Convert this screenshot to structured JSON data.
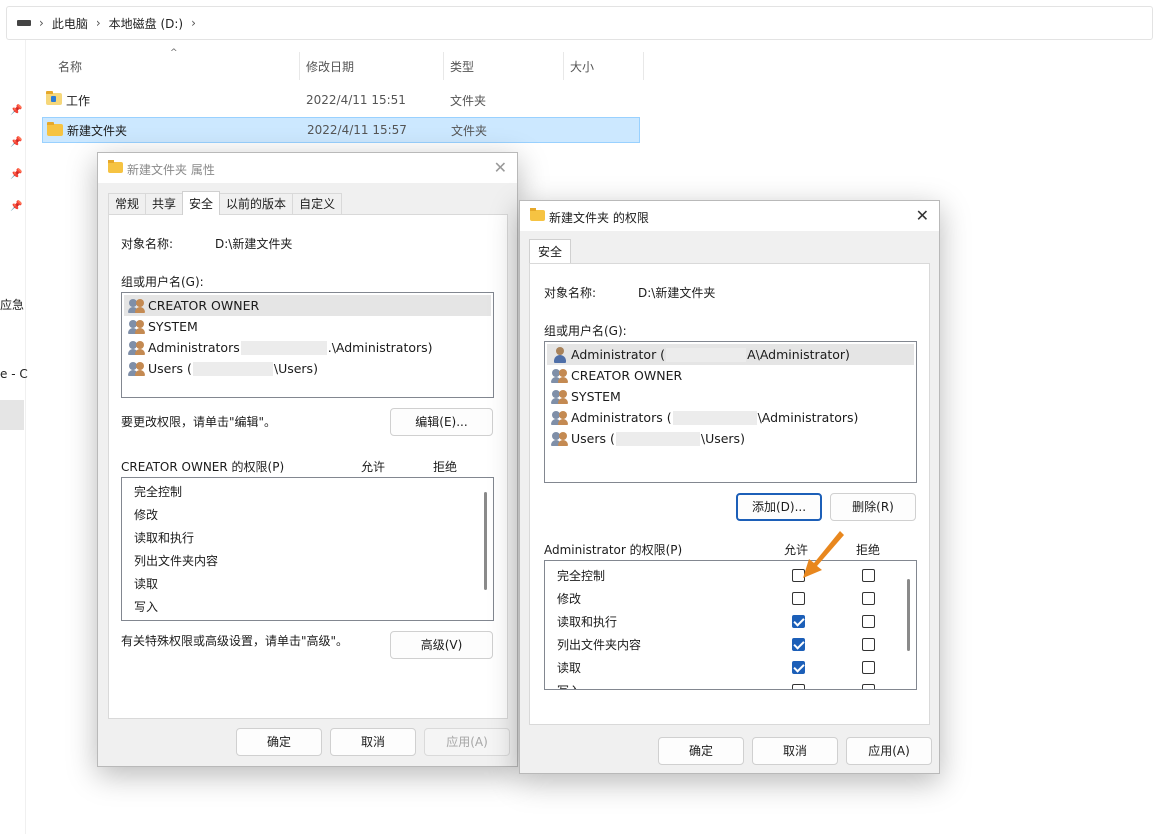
{
  "breadcrumb": {
    "items": [
      "此电脑",
      "本地磁盘 (D:)"
    ],
    "separator": "›"
  },
  "columns": {
    "name": "名称",
    "date": "修改日期",
    "type": "类型",
    "size": "大小"
  },
  "files": [
    {
      "name": "工作",
      "date": "2022/4/11 15:51",
      "type": "文件夹",
      "selected": false
    },
    {
      "name": "新建文件夹",
      "date": "2022/4/11 15:57",
      "type": "文件夹",
      "selected": true
    }
  ],
  "nav_fragments": [
    "应急",
    "e - C"
  ],
  "props_dialog": {
    "title": "新建文件夹 属性",
    "tabs": [
      "常规",
      "共享",
      "安全",
      "以前的版本",
      "自定义"
    ],
    "active_tab": "安全",
    "object_label": "对象名称:",
    "object_value": "D:\\新建文件夹",
    "group_label": "组或用户名(G):",
    "users": [
      {
        "name": "CREATOR OWNER",
        "suffix": ""
      },
      {
        "name": "SYSTEM",
        "suffix": ""
      },
      {
        "name": "Administrators",
        "suffix": ".\\Administrators)"
      },
      {
        "name": "Users (",
        "suffix": "\\Users)"
      }
    ],
    "edit_hint": "要更改权限，请单击\"编辑\"。",
    "edit_button": "编辑(E)...",
    "perm_label": "CREATOR OWNER 的权限(P)",
    "allow_label": "允许",
    "deny_label": "拒绝",
    "perms": [
      "完全控制",
      "修改",
      "读取和执行",
      "列出文件夹内容",
      "读取",
      "写入"
    ],
    "advanced_hint": "有关特殊权限或高级设置，请单击\"高级\"。",
    "advanced_button": "高级(V)",
    "ok": "确定",
    "cancel": "取消",
    "apply": "应用(A)"
  },
  "perm_dialog": {
    "title": "新建文件夹 的权限",
    "tab": "安全",
    "object_label": "对象名称:",
    "object_value": "D:\\新建文件夹",
    "group_label": "组或用户名(G):",
    "users": [
      {
        "name": "Administrator (",
        "suffix": "A\\Administrator)"
      },
      {
        "name": "CREATOR OWNER",
        "suffix": ""
      },
      {
        "name": "SYSTEM",
        "suffix": ""
      },
      {
        "name": "Administrators (",
        "suffix": "\\Administrators)"
      },
      {
        "name": "Users (",
        "suffix": "\\Users)"
      }
    ],
    "add_button": "添加(D)...",
    "remove_button": "删除(R)",
    "perm_label": "Administrator 的权限(P)",
    "allow_label": "允许",
    "deny_label": "拒绝",
    "perms": [
      {
        "label": "完全控制",
        "allow": false,
        "deny": false
      },
      {
        "label": "修改",
        "allow": false,
        "deny": false
      },
      {
        "label": "读取和执行",
        "allow": true,
        "deny": false
      },
      {
        "label": "列出文件夹内容",
        "allow": true,
        "deny": false
      },
      {
        "label": "读取",
        "allow": true,
        "deny": false
      },
      {
        "label": "写入",
        "allow": false,
        "deny": false
      }
    ],
    "ok": "确定",
    "cancel": "取消",
    "apply": "应用(A)"
  },
  "colors": {
    "accent": "#1c5fb8",
    "selection": "#cce8ff",
    "annotation_arrow": "#e8871e"
  }
}
